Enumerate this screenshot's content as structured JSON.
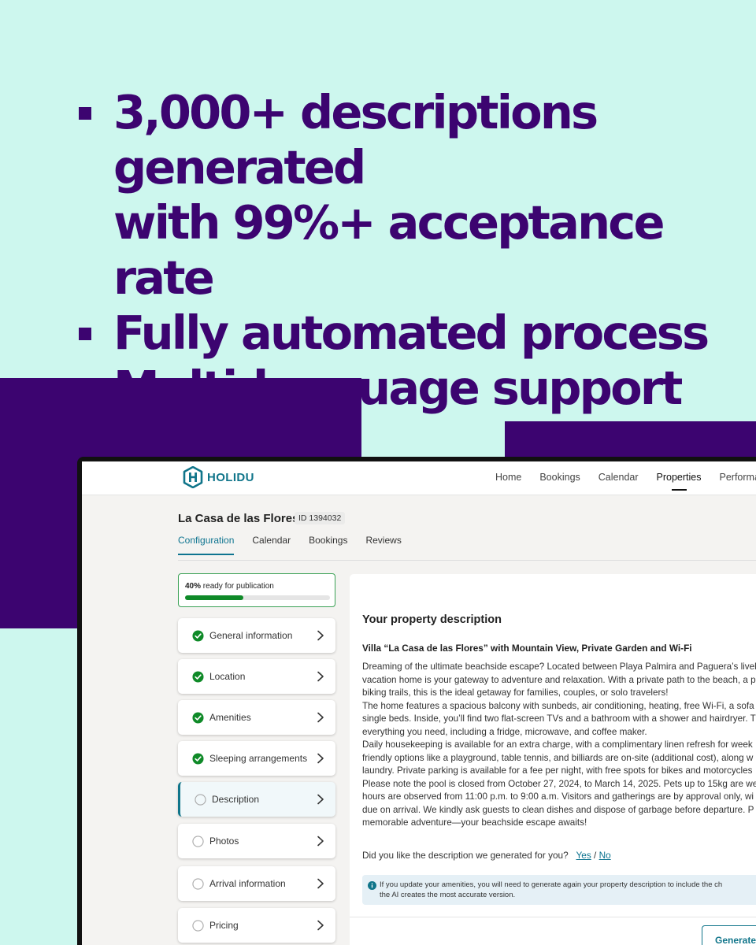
{
  "headline": {
    "bullets": [
      {
        "line1": "3,000+ descriptions generated",
        "line2": "with 99%+ acceptance rate"
      },
      {
        "line1": "Fully automated process"
      },
      {
        "line1": "Multi-language support"
      }
    ]
  },
  "app": {
    "brand": "HOLIDU",
    "colors": {
      "accent": "#10758a",
      "headline": "#3c0470",
      "success": "#0f8a28",
      "background": "#cdf7ee"
    },
    "nav": [
      "Home",
      "Bookings",
      "Calendar",
      "Properties",
      "Performance"
    ],
    "nav_active": "Properties",
    "property": {
      "title": "La Casa de las Flores",
      "id": "ID 1394032"
    },
    "tabs": [
      "Configuration",
      "Calendar",
      "Bookings",
      "Reviews"
    ],
    "tab_active": "Configuration",
    "progress": {
      "percent": "40%",
      "label": "ready for publication",
      "value": 0.4
    },
    "steps": [
      {
        "label": "General information",
        "done": true
      },
      {
        "label": "Location",
        "done": true
      },
      {
        "label": "Amenities",
        "done": true
      },
      {
        "label": "Sleeping arrangements",
        "done": true
      },
      {
        "label": "Description",
        "done": false,
        "active": true
      },
      {
        "label": "Photos",
        "done": false
      },
      {
        "label": "Arrival information",
        "done": false
      },
      {
        "label": "Pricing",
        "done": false
      }
    ],
    "description": {
      "heading": "Your property description",
      "subtitle": "Villa “La Casa de las Flores” with Mountain View, Private Garden and Wi-Fi",
      "body_lines": [
        "Dreaming of the ultimate beachside escape? Located between Playa Palmira and Paguera’s livel",
        "vacation home is your gateway to adventure and relaxation. With a private path to the beach, a p",
        "biking trails, this is the ideal getaway for families, couples, or solo travelers!",
        "The home features a spacious balcony with sunbeds, air conditioning, heating, free Wi-Fi, a sofa",
        "single beds. Inside, you’ll find two flat-screen TVs and a bathroom with a shower and hairdryer. T",
        "everything you need, including a fridge, microwave, and coffee maker.",
        "Daily housekeeping is available for an extra charge, with a complimentary linen refresh for week",
        "friendly options like a playground, table tennis, and billiards are on-site (additional cost), along w",
        "laundry. Private parking is available for a fee per night, with free spots for bikes and motorcycles",
        "Please note the pool is closed from October 27, 2024, to March 14, 2025. Pets up to 15kg are we",
        "hours are observed from 11:00 p.m. to 9:00 a.m. Visitors and gatherings are by approval only, wi",
        "due on arrival. We kindly ask guests to clean dishes and dispose of garbage before departure. P",
        "memorable adventure—your beachside escape awaits!"
      ],
      "feedback_question": "Did you like the description we generated for you?",
      "feedback_yes": "Yes",
      "feedback_sep": "/",
      "feedback_no": "No",
      "info_line1": "If you update your amenities, you will need to generate again your property description to include the ch",
      "info_line2": "the AI creates the most accurate version."
    },
    "generate_button": "Generate"
  }
}
